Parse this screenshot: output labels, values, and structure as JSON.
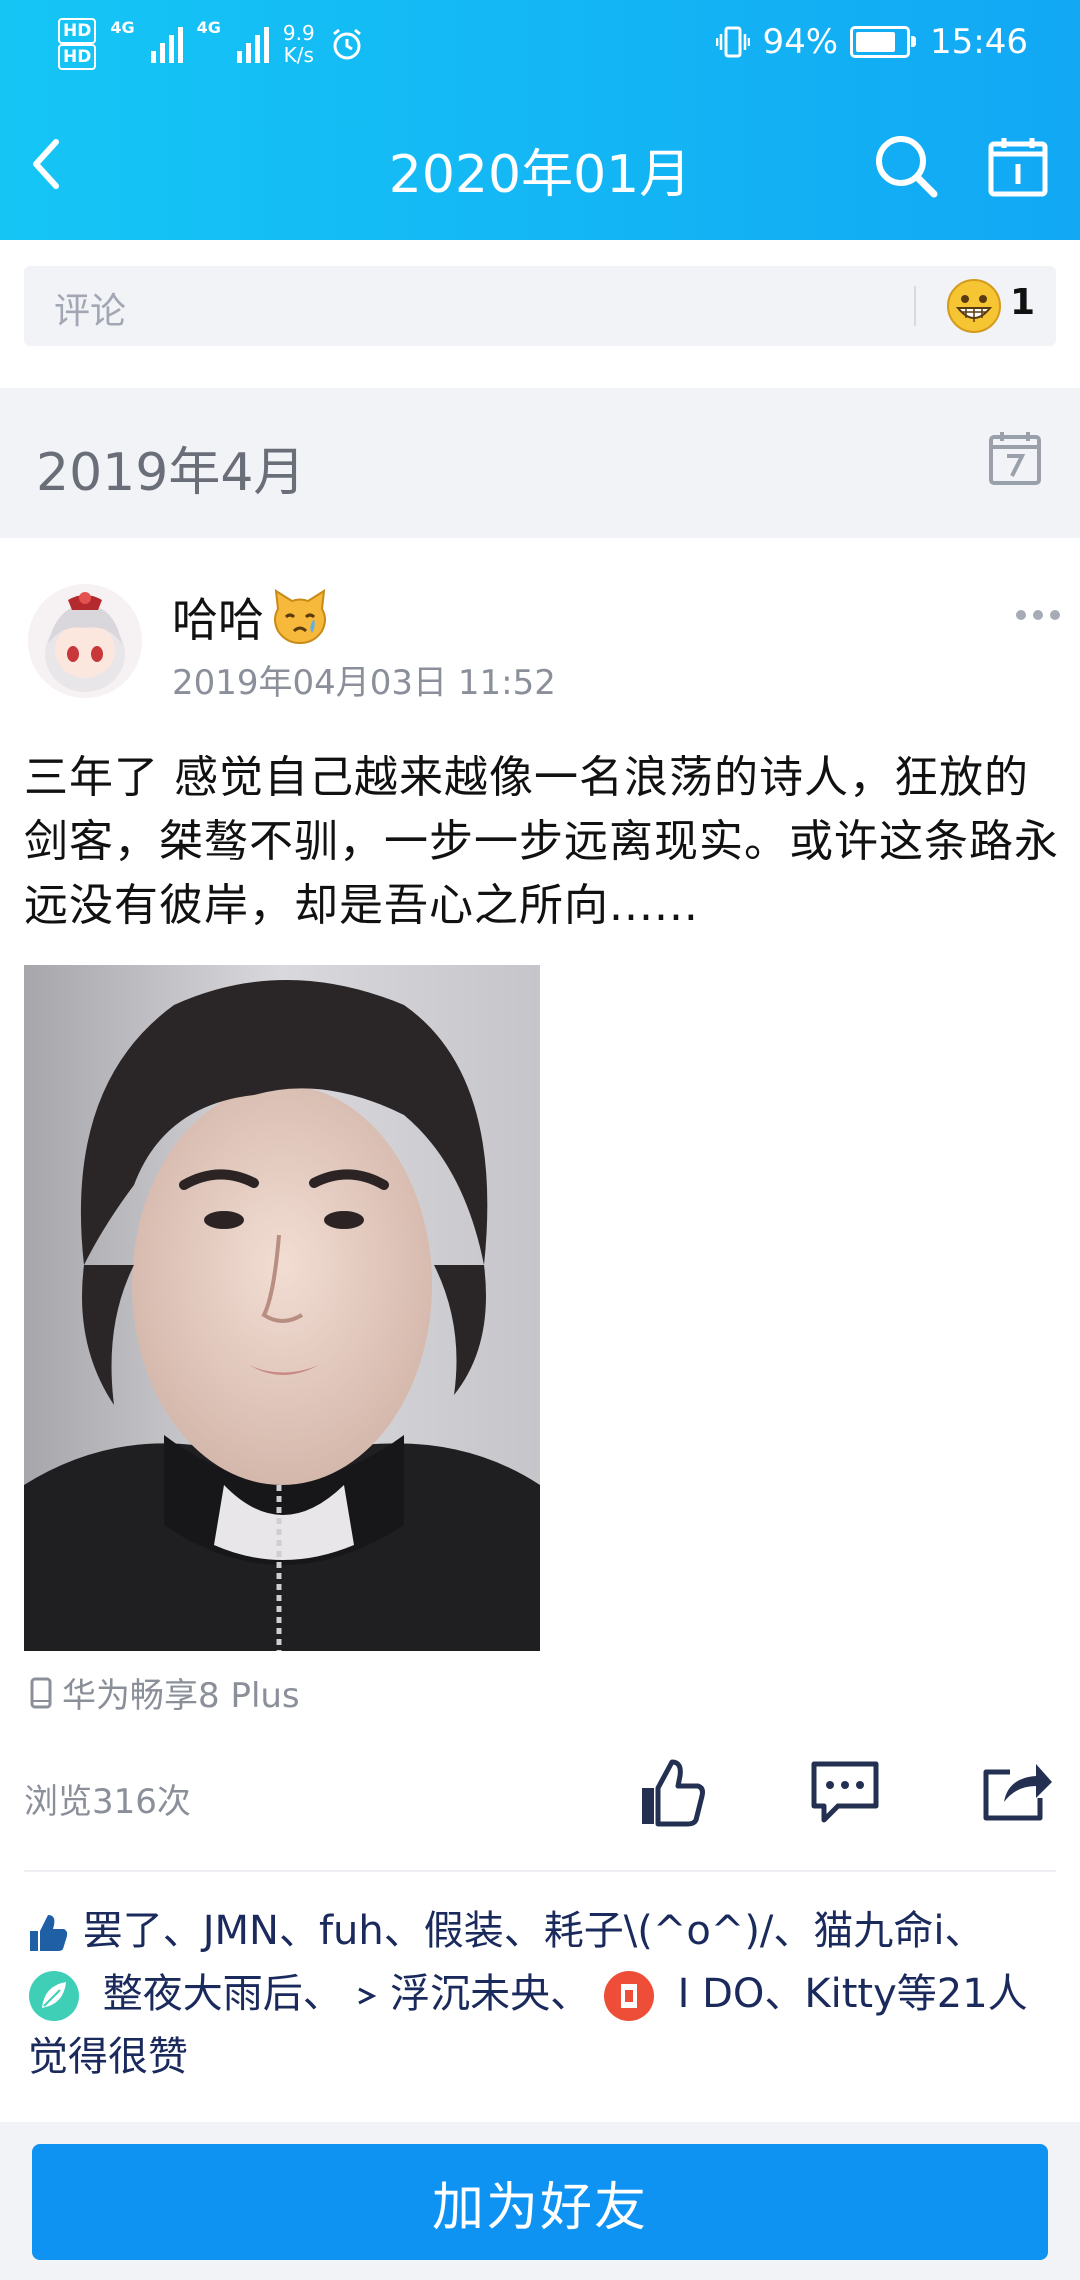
{
  "status_bar": {
    "hd1": "HD",
    "hd2": "HD",
    "net1": "4G",
    "net2": "4G",
    "speed_value": "9.9",
    "speed_unit": "K/s",
    "battery_percent": "94%",
    "battery_level": 0.94,
    "time": "15:46"
  },
  "header": {
    "title": "2020年01月"
  },
  "comment_bar": {
    "placeholder": "评论",
    "reaction_count": "1"
  },
  "section": {
    "date_label": "2019年4月"
  },
  "post": {
    "author": "哈哈",
    "timestamp": "2019年04月03日 11:52",
    "text": "三年了 感觉自己越来越像一名浪荡的诗人，狂放的剑客，桀骜不驯，一步一步远离现实。或许这条路永远没有彼岸，却是吾心之所向......",
    "device": "华为畅享8 Plus",
    "views": "浏览316次",
    "likes": {
      "line1": "罢了、JMN、fuh、假装、耗子\\(^o^)/、猫九命i、",
      "name_a": "整夜大雨后、",
      "name_b": "浮沉未央、",
      "name_c": "I DO、Kitty",
      "suffix": "等21人觉得很赞"
    }
  },
  "bottom": {
    "add_friend_label": "加为好友"
  },
  "colors": {
    "header_gradient_start": "#15c6f5",
    "header_gradient_end": "#12a8f4",
    "primary_button": "#0e93f3",
    "liker_name": "#1b2a5c",
    "secondary_text": "#8a8f99"
  }
}
